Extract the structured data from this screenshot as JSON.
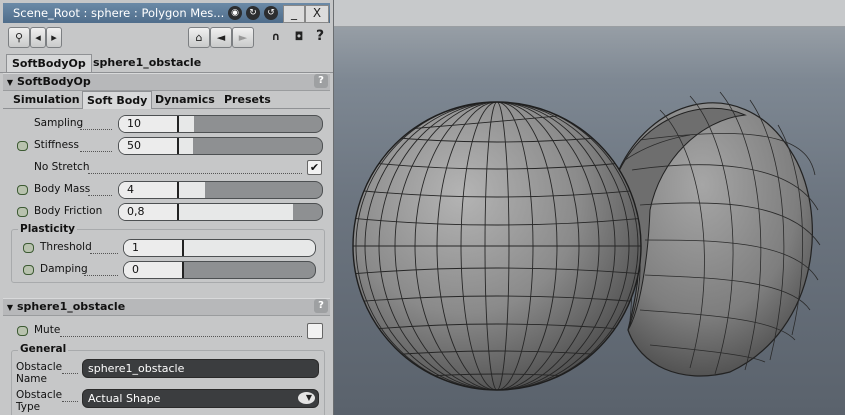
{
  "window": {
    "title": "Scene_Root : sphere : Polygon Mes...",
    "minimize": "_",
    "close": "X"
  },
  "toolbar": {
    "search_icon": "key-search-icon",
    "prev": "◂",
    "next": "▸",
    "help": "?"
  },
  "top_tabs": [
    "SoftBodyOp",
    "sphere1_obstacle"
  ],
  "softbody": {
    "header": "SoftBodyOp",
    "subtabs": [
      "Simulation",
      "Soft Body",
      "Dynamics",
      "Presets"
    ],
    "rows": [
      {
        "label": "Sampling",
        "value": "10",
        "fraction": 0.12,
        "animatable": false
      },
      {
        "label": "Stiffness",
        "value": "50",
        "fraction": 0.11,
        "animatable": true
      },
      {
        "label": "No Stretch",
        "checked": true
      },
      {
        "label": "Body Mass",
        "value": "4",
        "fraction": 0.19,
        "animatable": true
      },
      {
        "label": "Body Friction",
        "value": "0,8",
        "fraction": 0.8,
        "animatable": true
      }
    ],
    "plasticity": {
      "title": "Plasticity",
      "rows": [
        {
          "label": "Threshold",
          "value": "1",
          "fraction": 1.0
        },
        {
          "label": "Damping",
          "value": "0",
          "fraction": 0.0
        }
      ]
    }
  },
  "obstacle": {
    "header": "sphere1_obstacle",
    "mute_label": "Mute",
    "mute_checked": false,
    "general_title": "General",
    "name_label": "Obstacle Name",
    "name_value": "sphere1_obstacle",
    "type_label": "Obstacle Type",
    "type_value": "Actual Shape"
  },
  "help_glyph": "?",
  "check_glyph": "✔",
  "colors": {
    "title_bar": "#5a7896",
    "panel_bg": "#c6c7c8",
    "viewport_bg": "#6c7580",
    "sphere_fill": "#8f8f8f"
  }
}
